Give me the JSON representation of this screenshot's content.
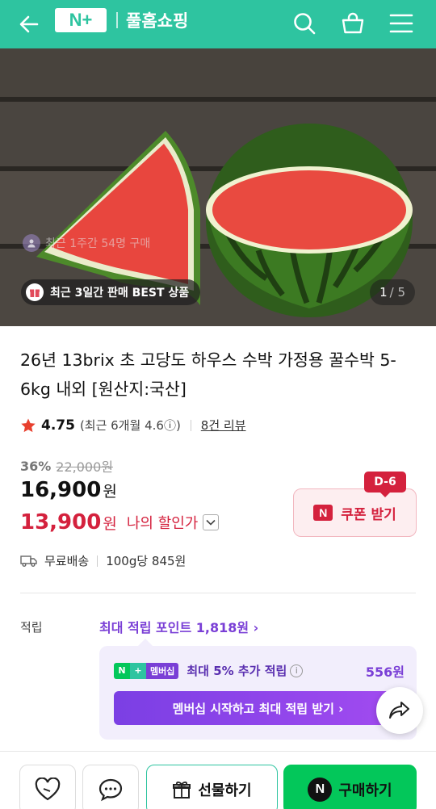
{
  "header": {
    "logo_text": "N+",
    "title": "풀홈쇼핑",
    "bg_color": "#2ec4a0",
    "icons": [
      "back-arrow-icon",
      "search-icon",
      "basket-icon",
      "menu-icon"
    ]
  },
  "hero": {
    "recent_buyers": "최근 1주간 54명 구매",
    "best_badge": "최근 3일간 판매 BEST 상품",
    "pager_current": "1",
    "pager_total": "/ 5"
  },
  "product": {
    "title": "26년 13brix 초 고당도 하우스 수박 가정용 꿀수박 5-6kg 내외 [원산지:국산]",
    "rating": "4.75",
    "recent_rating": "(최근 6개월 4.6ⓘ)",
    "reviews": "8건 리뷰",
    "discount_pct": "36%",
    "original_price": "22,000원",
    "price": "16,900",
    "price_unit": "원",
    "my_price": "13,900",
    "my_price_unit": "원",
    "my_price_label": "나의 할인가",
    "coupon_dday": "D-6",
    "coupon_mark": "N",
    "coupon_label": "쿠폰 받기",
    "shipping": "무료배송",
    "unit_price": "100g당 845원"
  },
  "points": {
    "label": "적립",
    "max_points": "최대 적립 포인트 1,818원 ›",
    "membership_tag": "멤버십",
    "membership_text": "최대 5% 추가 적립",
    "membership_amount": "556원",
    "membership_button": "멤버십 시작하고 최대 적립 받기 ›"
  },
  "bottom_bar": {
    "gift_label": "선물하기",
    "buy_label": "구매하기",
    "buy_logo": "N"
  },
  "colors": {
    "accent": "#2ec4a0",
    "sale_red": "#d4213d",
    "purple": "#7a3fd6",
    "buy_green": "#03c75a"
  }
}
